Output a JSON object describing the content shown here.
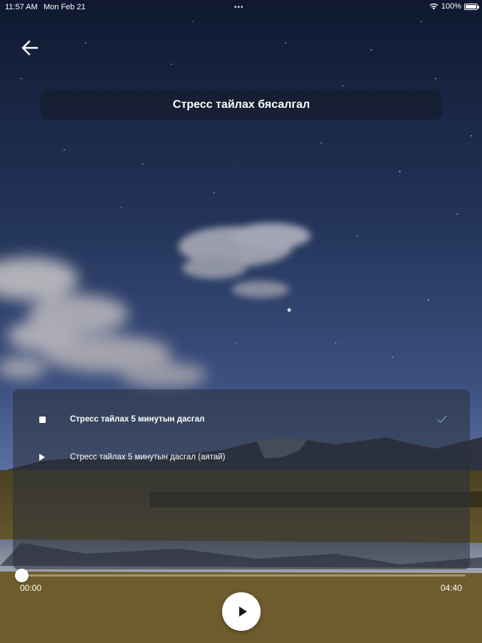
{
  "status_bar": {
    "time": "11:57 AM",
    "date": "Mon Feb 21",
    "dots": "•••",
    "battery": "100%"
  },
  "header": {
    "title": "Стресс тайлах бясалгал",
    "back_icon": "arrow-left-icon"
  },
  "playlist": {
    "tracks": [
      {
        "label": "Стресс тайлах 5 минутын дасгал",
        "state": "playing",
        "icon": "stop-icon",
        "completed": true
      },
      {
        "label": "Стресс тайлах 5 минутын дасгал (аятай)",
        "state": "idle",
        "icon": "play-icon",
        "completed": false
      }
    ]
  },
  "player": {
    "elapsed": "00:00",
    "total": "04:40",
    "progress": 0,
    "play_icon": "play-icon"
  },
  "colors": {
    "sky_top": "#0f1830",
    "sky_mid": "#3a4d78",
    "sky_low": "#5d73a0",
    "ground": "#6b5a2c",
    "accent_check": "#6fa8b3"
  }
}
